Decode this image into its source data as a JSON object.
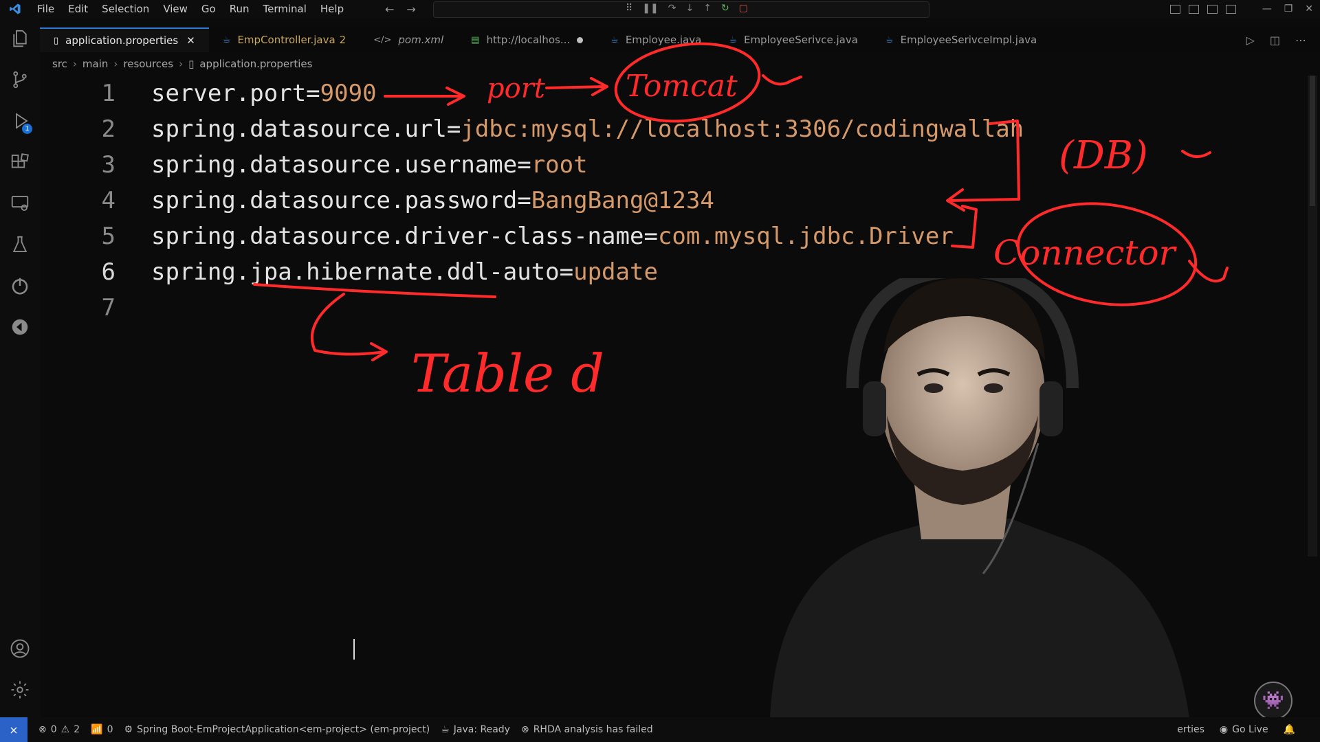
{
  "menu": [
    "File",
    "Edit",
    "Selection",
    "View",
    "Go",
    "Run",
    "Terminal",
    "Help"
  ],
  "tabs": [
    {
      "label": "application.properties",
      "icon": "gear-file-icon",
      "active": true,
      "close": "✕"
    },
    {
      "label": "EmpController.java",
      "icon": "java-icon",
      "count": "2",
      "warn": true
    },
    {
      "label": "pom.xml",
      "icon": "xml-icon",
      "italic": true
    },
    {
      "label": "http://localhos...",
      "icon": "browser-preview-icon",
      "dirty": true
    },
    {
      "label": "Employee.java",
      "icon": "java-icon"
    },
    {
      "label": "EmployeeSerivce.java",
      "icon": "java-icon"
    },
    {
      "label": "EmployeeSerivceImpl.java",
      "icon": "java-icon"
    }
  ],
  "breadcrumb": [
    "src",
    "main",
    "resources",
    "application.properties"
  ],
  "code": [
    {
      "num": "1",
      "key": "server.port",
      "value": "9090"
    },
    {
      "num": "2",
      "key": "spring.datasource.url",
      "value": "jdbc:mysql://localhost:3306/codingwallah"
    },
    {
      "num": "3",
      "key": "spring.datasource.username",
      "value": "root"
    },
    {
      "num": "4",
      "key": "spring.datasource.password",
      "value": "BangBang@1234"
    },
    {
      "num": "5",
      "key": "spring.datasource.driver-class-name",
      "value": "com.mysql.jdbc.Driver"
    },
    {
      "num": "6",
      "key": "spring.jpa.hibernate.ddl-auto",
      "value": "update"
    },
    {
      "num": "7",
      "key": "",
      "value": ""
    }
  ],
  "annotations": {
    "port": "port",
    "tomcat": "Tomcat",
    "db": "(DB)",
    "connector": "Connector",
    "table": "Table d"
  },
  "status": {
    "errors": "0",
    "warnings": "2",
    "ports": "0",
    "run_config": "Spring Boot-EmProjectApplication<em-project> (em-project)",
    "java": "Java: Ready",
    "rhda": "RHDA analysis has failed",
    "right_partial": "erties",
    "go_live": "Go Live"
  },
  "colors": {
    "accent": "#2b62c8",
    "annotation": "#ff2a2a",
    "value": "#d69a6a",
    "background": "#0b0b0b"
  }
}
